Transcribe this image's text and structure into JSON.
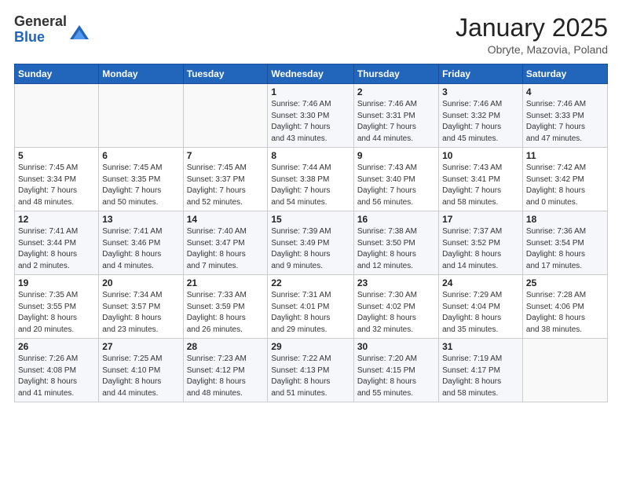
{
  "logo": {
    "general": "General",
    "blue": "Blue"
  },
  "header": {
    "month": "January 2025",
    "location": "Obryte, Mazovia, Poland"
  },
  "weekdays": [
    "Sunday",
    "Monday",
    "Tuesday",
    "Wednesday",
    "Thursday",
    "Friday",
    "Saturday"
  ],
  "weeks": [
    [
      {
        "day": "",
        "detail": ""
      },
      {
        "day": "",
        "detail": ""
      },
      {
        "day": "",
        "detail": ""
      },
      {
        "day": "1",
        "detail": "Sunrise: 7:46 AM\nSunset: 3:30 PM\nDaylight: 7 hours\nand 43 minutes."
      },
      {
        "day": "2",
        "detail": "Sunrise: 7:46 AM\nSunset: 3:31 PM\nDaylight: 7 hours\nand 44 minutes."
      },
      {
        "day": "3",
        "detail": "Sunrise: 7:46 AM\nSunset: 3:32 PM\nDaylight: 7 hours\nand 45 minutes."
      },
      {
        "day": "4",
        "detail": "Sunrise: 7:46 AM\nSunset: 3:33 PM\nDaylight: 7 hours\nand 47 minutes."
      }
    ],
    [
      {
        "day": "5",
        "detail": "Sunrise: 7:45 AM\nSunset: 3:34 PM\nDaylight: 7 hours\nand 48 minutes."
      },
      {
        "day": "6",
        "detail": "Sunrise: 7:45 AM\nSunset: 3:35 PM\nDaylight: 7 hours\nand 50 minutes."
      },
      {
        "day": "7",
        "detail": "Sunrise: 7:45 AM\nSunset: 3:37 PM\nDaylight: 7 hours\nand 52 minutes."
      },
      {
        "day": "8",
        "detail": "Sunrise: 7:44 AM\nSunset: 3:38 PM\nDaylight: 7 hours\nand 54 minutes."
      },
      {
        "day": "9",
        "detail": "Sunrise: 7:43 AM\nSunset: 3:40 PM\nDaylight: 7 hours\nand 56 minutes."
      },
      {
        "day": "10",
        "detail": "Sunrise: 7:43 AM\nSunset: 3:41 PM\nDaylight: 7 hours\nand 58 minutes."
      },
      {
        "day": "11",
        "detail": "Sunrise: 7:42 AM\nSunset: 3:42 PM\nDaylight: 8 hours\nand 0 minutes."
      }
    ],
    [
      {
        "day": "12",
        "detail": "Sunrise: 7:41 AM\nSunset: 3:44 PM\nDaylight: 8 hours\nand 2 minutes."
      },
      {
        "day": "13",
        "detail": "Sunrise: 7:41 AM\nSunset: 3:46 PM\nDaylight: 8 hours\nand 4 minutes."
      },
      {
        "day": "14",
        "detail": "Sunrise: 7:40 AM\nSunset: 3:47 PM\nDaylight: 8 hours\nand 7 minutes."
      },
      {
        "day": "15",
        "detail": "Sunrise: 7:39 AM\nSunset: 3:49 PM\nDaylight: 8 hours\nand 9 minutes."
      },
      {
        "day": "16",
        "detail": "Sunrise: 7:38 AM\nSunset: 3:50 PM\nDaylight: 8 hours\nand 12 minutes."
      },
      {
        "day": "17",
        "detail": "Sunrise: 7:37 AM\nSunset: 3:52 PM\nDaylight: 8 hours\nand 14 minutes."
      },
      {
        "day": "18",
        "detail": "Sunrise: 7:36 AM\nSunset: 3:54 PM\nDaylight: 8 hours\nand 17 minutes."
      }
    ],
    [
      {
        "day": "19",
        "detail": "Sunrise: 7:35 AM\nSunset: 3:55 PM\nDaylight: 8 hours\nand 20 minutes."
      },
      {
        "day": "20",
        "detail": "Sunrise: 7:34 AM\nSunset: 3:57 PM\nDaylight: 8 hours\nand 23 minutes."
      },
      {
        "day": "21",
        "detail": "Sunrise: 7:33 AM\nSunset: 3:59 PM\nDaylight: 8 hours\nand 26 minutes."
      },
      {
        "day": "22",
        "detail": "Sunrise: 7:31 AM\nSunset: 4:01 PM\nDaylight: 8 hours\nand 29 minutes."
      },
      {
        "day": "23",
        "detail": "Sunrise: 7:30 AM\nSunset: 4:02 PM\nDaylight: 8 hours\nand 32 minutes."
      },
      {
        "day": "24",
        "detail": "Sunrise: 7:29 AM\nSunset: 4:04 PM\nDaylight: 8 hours\nand 35 minutes."
      },
      {
        "day": "25",
        "detail": "Sunrise: 7:28 AM\nSunset: 4:06 PM\nDaylight: 8 hours\nand 38 minutes."
      }
    ],
    [
      {
        "day": "26",
        "detail": "Sunrise: 7:26 AM\nSunset: 4:08 PM\nDaylight: 8 hours\nand 41 minutes."
      },
      {
        "day": "27",
        "detail": "Sunrise: 7:25 AM\nSunset: 4:10 PM\nDaylight: 8 hours\nand 44 minutes."
      },
      {
        "day": "28",
        "detail": "Sunrise: 7:23 AM\nSunset: 4:12 PM\nDaylight: 8 hours\nand 48 minutes."
      },
      {
        "day": "29",
        "detail": "Sunrise: 7:22 AM\nSunset: 4:13 PM\nDaylight: 8 hours\nand 51 minutes."
      },
      {
        "day": "30",
        "detail": "Sunrise: 7:20 AM\nSunset: 4:15 PM\nDaylight: 8 hours\nand 55 minutes."
      },
      {
        "day": "31",
        "detail": "Sunrise: 7:19 AM\nSunset: 4:17 PM\nDaylight: 8 hours\nand 58 minutes."
      },
      {
        "day": "",
        "detail": ""
      }
    ]
  ]
}
